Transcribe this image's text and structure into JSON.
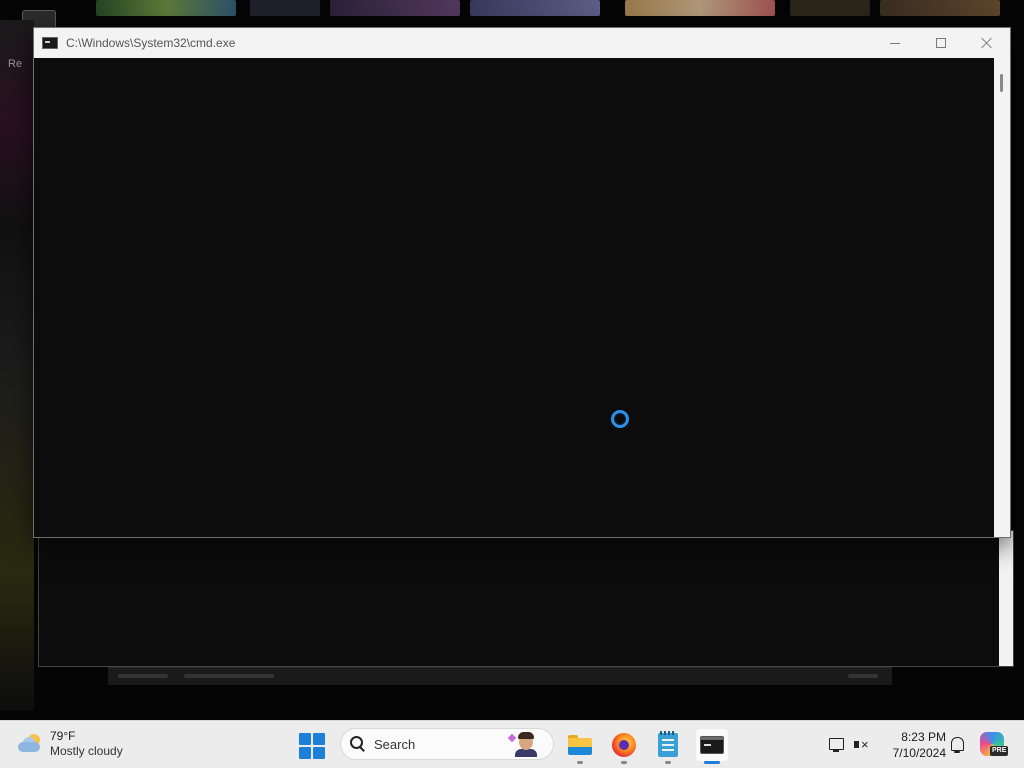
{
  "window": {
    "title": "C:\\Windows\\System32\\cmd.exe",
    "minimize_glyph": "minimize-icon",
    "maximize_glyph": "maximize-icon",
    "close_glyph": "close-icon"
  },
  "desktop": {
    "left_label": "Re"
  },
  "taskbar": {
    "weather": {
      "temperature": "79°F",
      "condition": "Mostly cloudy",
      "icon": "partly-cloudy-icon"
    },
    "search": {
      "label": "Search",
      "icon": "search-icon"
    },
    "pinned_apps": [
      {
        "name": "File Explorer",
        "icon": "folder-icon"
      },
      {
        "name": "Firefox",
        "icon": "firefox-icon"
      },
      {
        "name": "Notepad",
        "icon": "notepad-icon"
      },
      {
        "name": "Command Prompt",
        "icon": "terminal-icon",
        "active": true
      }
    ],
    "tray": {
      "time": "8:23 PM",
      "date": "7/10/2024",
      "copilot_badge": "PRE"
    }
  },
  "colors": {
    "console_bg": "#0c0c0c",
    "accent": "#1c7fd8",
    "busy_cursor": "#2f8fe6",
    "taskbar_bg": "#ececec"
  }
}
